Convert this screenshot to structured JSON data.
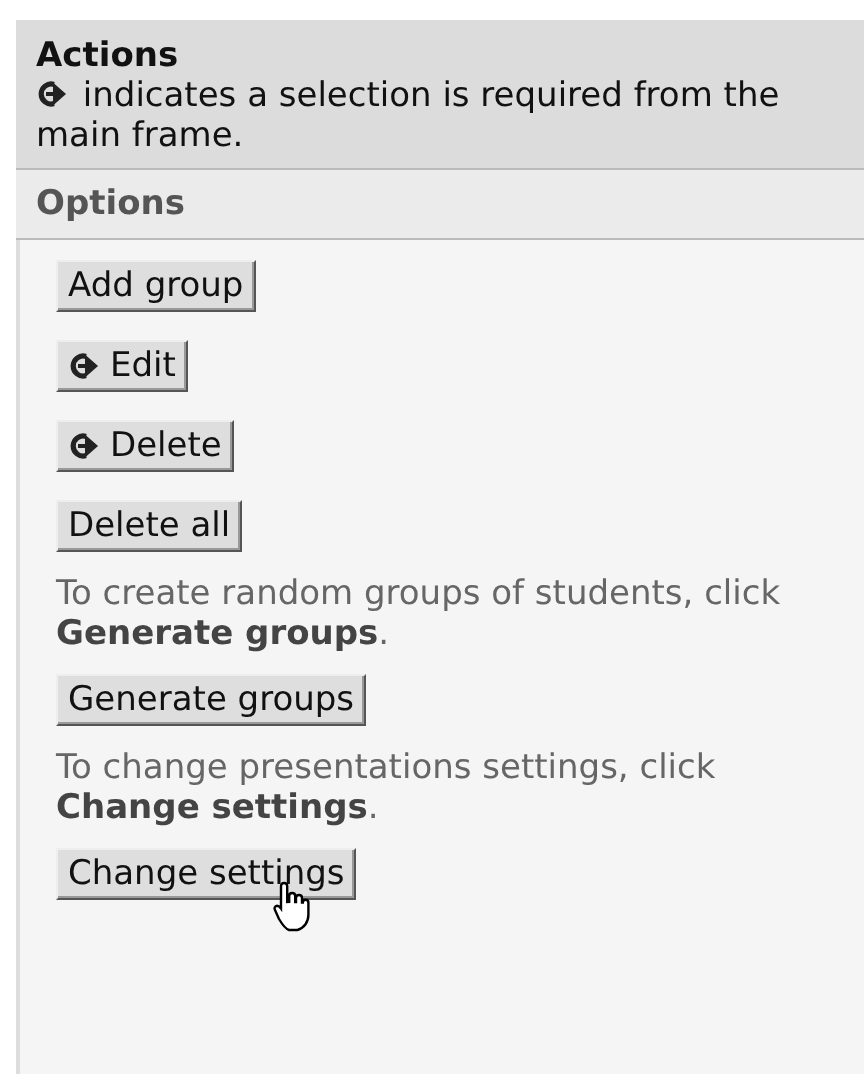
{
  "actions": {
    "title": "Actions",
    "note": "indicates a selection is required from the main frame."
  },
  "options": {
    "title": "Options",
    "items": [
      {
        "kind": "button",
        "label": "Add group",
        "requires_selection": false
      },
      {
        "kind": "button",
        "label": "Edit",
        "requires_selection": true
      },
      {
        "kind": "button",
        "label": "Delete",
        "requires_selection": true
      },
      {
        "kind": "button",
        "label": "Delete all",
        "requires_selection": false
      },
      {
        "kind": "hint",
        "text": "To create random groups of students, click **Generate groups**."
      },
      {
        "kind": "button",
        "label": "Generate groups",
        "requires_selection": false
      },
      {
        "kind": "hint",
        "text": "To change presentations settings, click **Change settings**."
      },
      {
        "kind": "button",
        "label": "Change settings",
        "requires_selection": false,
        "hovered": true
      }
    ]
  }
}
